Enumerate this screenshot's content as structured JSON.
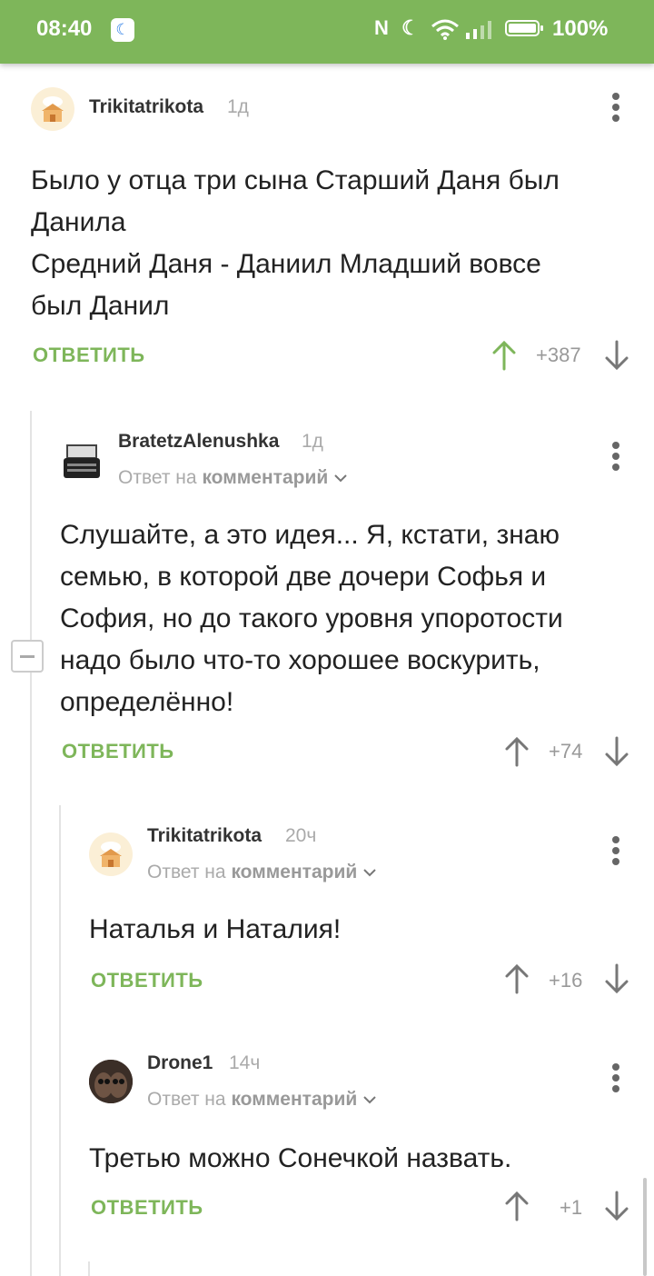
{
  "status_bar": {
    "time": "08:40",
    "battery": "100%",
    "icons": [
      "moon-badge-icon",
      "nfc-icon",
      "do-not-disturb-icon",
      "wifi-icon",
      "signal-icon",
      "battery-icon"
    ]
  },
  "colors": {
    "accent": "#7eb65a",
    "muted": "#aaaaaa",
    "text": "#222222"
  },
  "reply_to": {
    "prefix": "Ответ на",
    "link": "комментарий"
  },
  "reply_label": "ОТВЕТИТЬ",
  "comments": [
    {
      "author": "Trikitatrikota",
      "age": "1д",
      "lines": [
        "Было у отца три сына Старший Даня был",
        "Данила",
        "Средний Даня - Даниил Младший вовсе",
        "был Данил"
      ],
      "score": "+387",
      "upvoted": true
    },
    {
      "author": "BratetzAlenushka",
      "age": "1д",
      "lines": [
        "Слушайте, а это идея... Я, кстати, знаю",
        "семью, в которой две дочери Софья и",
        "София, но до такого уровня упоротости",
        "надо было что-то хорошее воскурить,",
        "определённо!"
      ],
      "score": "+74",
      "upvoted": false
    },
    {
      "author": "Trikitatrikota",
      "age": "20ч",
      "lines": [
        "Наталья и Наталия!"
      ],
      "score": "+16",
      "upvoted": false
    },
    {
      "author": "Drone1",
      "age": "14ч",
      "lines": [
        "Третью можно Сонечкой назвать."
      ],
      "score": "+1",
      "upvoted": false
    }
  ]
}
